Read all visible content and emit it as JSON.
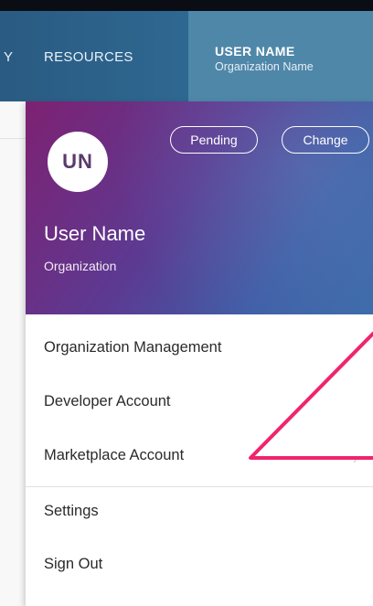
{
  "nav": {
    "partial_item": "Y",
    "resources": "RESOURCES",
    "user_name": "USER NAME",
    "org_name": "Organization Name"
  },
  "profile": {
    "initials": "UN",
    "pending_label": "Pending",
    "change_label": "Change",
    "name": "User Name",
    "organization": "Organization"
  },
  "menu": {
    "items": [
      {
        "label": "Organization Management"
      },
      {
        "label": "Developer Account"
      },
      {
        "label": "Marketplace Account"
      },
      {
        "label": "Settings"
      },
      {
        "label": "Sign Out"
      }
    ]
  },
  "colors": {
    "navbar": "#2f6a94",
    "user_block": "#4f87a9",
    "gradient_purple": "#7e2172",
    "gradient_blue": "#3c6aa8",
    "annotation_arrow": "#f0246e"
  }
}
